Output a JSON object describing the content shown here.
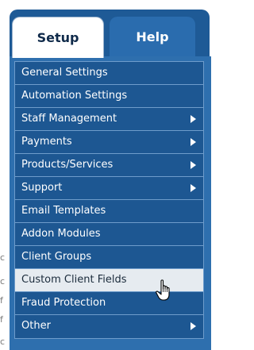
{
  "tabs": [
    {
      "label": "Setup",
      "active": true
    },
    {
      "label": "Help",
      "active": false
    }
  ],
  "menu": {
    "items": [
      {
        "label": "General Settings",
        "has_submenu": false
      },
      {
        "label": "Automation Settings",
        "has_submenu": false
      },
      {
        "label": "Staff Management",
        "has_submenu": true
      },
      {
        "label": "Payments",
        "has_submenu": true
      },
      {
        "label": "Products/Services",
        "has_submenu": true
      },
      {
        "label": "Support",
        "has_submenu": true
      },
      {
        "label": "Email Templates",
        "has_submenu": false
      },
      {
        "label": "Addon Modules",
        "has_submenu": false
      },
      {
        "label": "Client Groups",
        "has_submenu": false
      },
      {
        "label": "Custom Client Fields",
        "has_submenu": false,
        "hovered": true
      },
      {
        "label": "Fraud Protection",
        "has_submenu": false
      },
      {
        "label": "Other",
        "has_submenu": true
      }
    ]
  },
  "background_fragments": [
    "c",
    "c",
    "f",
    "f",
    "c"
  ],
  "icons": {
    "cursor": "hand-pointer-icon",
    "submenu": "triangle-right-icon"
  },
  "colors": {
    "menu_bg": "#1d5792",
    "menu_frame": "#2e6fae",
    "hover_bg": "#e6ebf0",
    "tab_active_bg": "#ffffff",
    "tab_inactive_bg": "#2a6cae"
  }
}
